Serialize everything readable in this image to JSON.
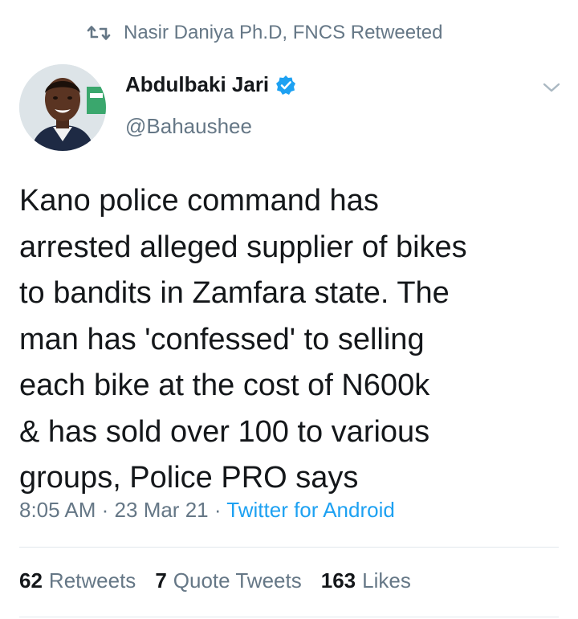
{
  "retweet_context": {
    "icon": "retweet-icon",
    "text": "Nasir Daniya Ph.D, FNCS Retweeted"
  },
  "author": {
    "name": "Abdulbaki Jari",
    "handle": "@Bahaushee",
    "verified": true,
    "verified_icon": "verified-badge-icon",
    "verified_color": "#1da1f2"
  },
  "tweet": {
    "text": "Kano police command has\narrested alleged supplier of bikes\nto bandits in Zamfara state. The\nman has 'confessed' to selling\neach bike at the cost of N600k\n& has sold over 100 to various\ngroups, Police PRO says",
    "time": "8:05 AM",
    "separator": "·",
    "date": "23 Mar 21",
    "source": "Twitter for Android"
  },
  "stats": {
    "retweets_count": "62",
    "retweets_label": "Retweets",
    "quote_count": "7",
    "quote_label": "Quote Tweets",
    "likes_count": "163",
    "likes_label": "Likes"
  },
  "colors": {
    "accent": "#1da1f2",
    "secondary_text": "#657786",
    "primary_text": "#14171a",
    "divider": "#e1e8ed"
  }
}
